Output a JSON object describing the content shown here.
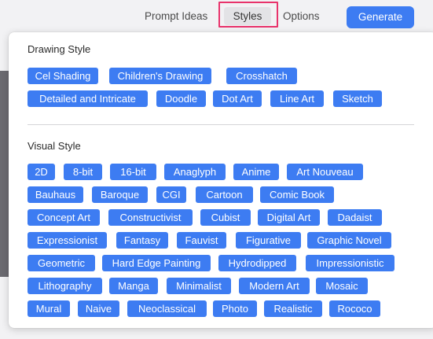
{
  "nav": {
    "prompt_ideas": "Prompt Ideas",
    "styles": "Styles",
    "options": "Options",
    "generate": "Generate"
  },
  "drawing_style": {
    "title": "Drawing Style",
    "rows": [
      [
        "Cel Shading",
        "Children's Drawing",
        "Crosshatch"
      ],
      [
        "Detailed and Intricate",
        "Doodle",
        "Dot Art",
        "Line Art",
        "Sketch"
      ]
    ]
  },
  "visual_style": {
    "title": "Visual Style",
    "rows": [
      [
        "2D",
        "8-bit",
        "16-bit",
        "Anaglyph",
        "Anime",
        "Art Nouveau"
      ],
      [
        "Bauhaus",
        "Baroque",
        "CGI",
        "Cartoon",
        "Comic Book"
      ],
      [
        "Concept Art",
        "Constructivist",
        "Cubist",
        "Digital Art",
        "Dadaist"
      ],
      [
        "Expressionist",
        "Fantasy",
        "Fauvist",
        "Figurative",
        "Graphic Novel"
      ],
      [
        "Geometric",
        "Hard Edge Painting",
        "Hydrodipped",
        "Impressionistic"
      ],
      [
        "Lithography",
        "Manga",
        "Minimalist",
        "Modern Art",
        "Mosaic"
      ],
      [
        "Mural",
        "Naive",
        "Neoclassical",
        "Photo",
        "Realistic",
        "Rococo"
      ]
    ]
  },
  "colors": {
    "accent": "#3d7cf2",
    "highlight_border": "#e8336b"
  }
}
